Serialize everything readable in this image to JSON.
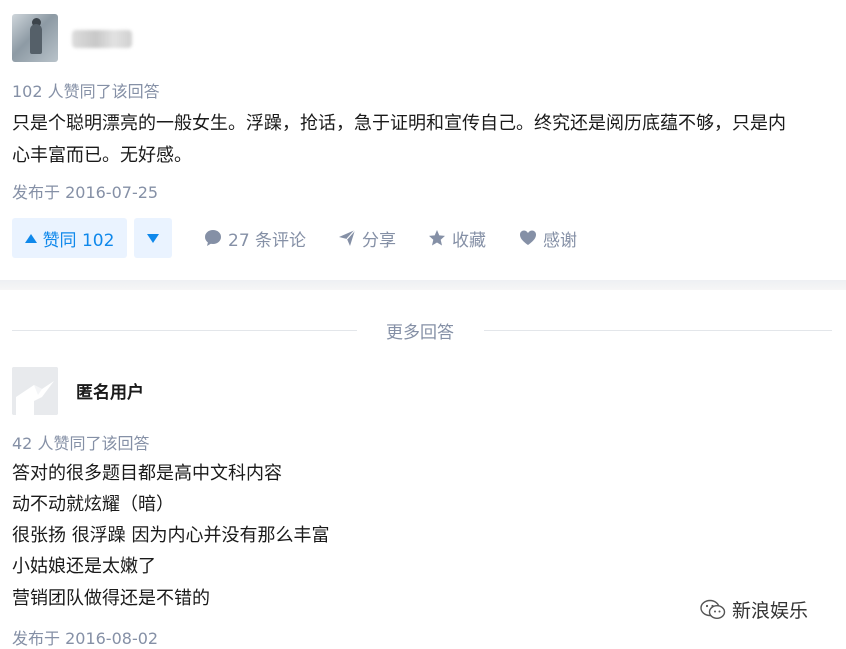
{
  "answer1": {
    "votes_text": "102 人赞同了该回答",
    "content_line1": "只是个聪明漂亮的一般女生。浮躁，抢话，急于证明和宣传自己。终究还是阅历底蕴不够，只是内",
    "content_line2": "心丰富而已。无好感。",
    "published": "发布于 2016-07-25",
    "actions": {
      "upvote_label": "赞同 102",
      "comments_label": "27 条评论",
      "share_label": "分享",
      "collect_label": "收藏",
      "thanks_label": "感谢"
    }
  },
  "more_answers_label": "更多回答",
  "answer2": {
    "author": "匿名用户",
    "votes_text": "42 人赞同了该回答",
    "lines": [
      "答对的很多题目都是高中文科内容",
      "动不动就炫耀（暗）",
      "很张扬 很浮躁 因为内心并没有那么丰富",
      "小姑娘还是太嫩了",
      "营销团队做得还是不错的"
    ],
    "published": "发布于 2016-08-02"
  },
  "watermark": "新浪娱乐",
  "colors": {
    "accent": "#0f88eb",
    "accent_bg": "#eaf3ff",
    "meta": "#8590a6"
  },
  "icons": [
    "up-triangle-icon",
    "down-triangle-icon",
    "comment-icon",
    "share-icon",
    "star-icon",
    "heart-icon",
    "wechat-icon"
  ]
}
